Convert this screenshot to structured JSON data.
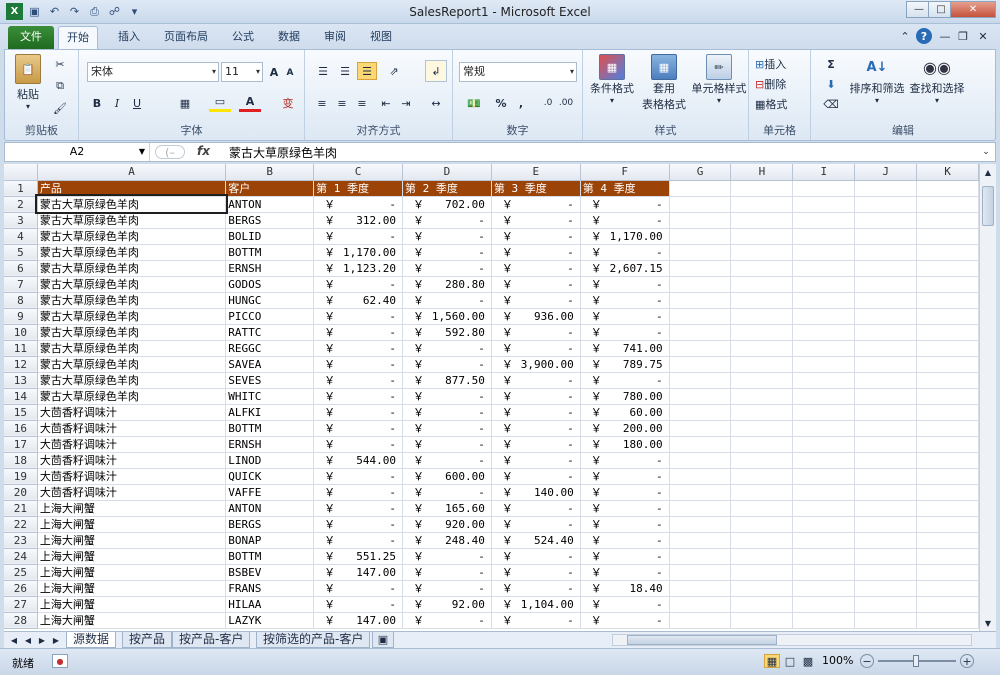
{
  "window": {
    "title": "SalesReport1 - Microsoft Excel"
  },
  "tabs": [
    {
      "label": "文件"
    },
    {
      "label": "开始"
    },
    {
      "label": "插入"
    },
    {
      "label": "页面布局"
    },
    {
      "label": "公式"
    },
    {
      "label": "数据"
    },
    {
      "label": "审阅"
    },
    {
      "label": "视图"
    }
  ],
  "ribbon": {
    "clipboard": {
      "label": "剪贴板",
      "paste": "粘贴"
    },
    "font": {
      "label": "字体",
      "name": "宋体",
      "size": "11",
      "bold": "B",
      "italic": "I",
      "underline": "U",
      "grow": "A",
      "shrink": "A",
      "fontcolor": "A",
      "phonetic": "变"
    },
    "alignment": {
      "label": "对齐方式"
    },
    "number": {
      "label": "数字",
      "format": "常规",
      "percent": "%",
      "comma": ","
    },
    "styles": {
      "label": "样式",
      "conditional": "条件格式",
      "table1": "套用",
      "table2": "表格格式",
      "cell": "单元格样式"
    },
    "cells": {
      "label": "单元格",
      "insert": "插入",
      "delete": "删除",
      "format": "格式"
    },
    "editing": {
      "label": "编辑",
      "sort": "排序和筛选",
      "find": "查找和选择"
    }
  },
  "formulabar": {
    "namebox": "A2",
    "fx": "fx",
    "content": "蒙古大草原绿色羊肉"
  },
  "columns": [
    "A",
    "B",
    "C",
    "D",
    "E",
    "F",
    "G",
    "H",
    "I",
    "J",
    "K"
  ],
  "header_row": [
    "产品",
    "客户",
    "第 1 季度",
    "第 2 季度",
    "第 3 季度",
    "第 4 季度"
  ],
  "rows": [
    {
      "n": "2",
      "p": "蒙古大草原绿色羊肉",
      "c": "ANTON",
      "q": [
        "-",
        "702.00",
        "-",
        "-"
      ]
    },
    {
      "n": "3",
      "p": "蒙古大草原绿色羊肉",
      "c": "BERGS",
      "q": [
        "312.00",
        "-",
        "-",
        "-"
      ]
    },
    {
      "n": "4",
      "p": "蒙古大草原绿色羊肉",
      "c": "BOLID",
      "q": [
        "-",
        "-",
        "-",
        "1,170.00"
      ]
    },
    {
      "n": "5",
      "p": "蒙古大草原绿色羊肉",
      "c": "BOTTM",
      "q": [
        "1,170.00",
        "-",
        "-",
        "-"
      ]
    },
    {
      "n": "6",
      "p": "蒙古大草原绿色羊肉",
      "c": "ERNSH",
      "q": [
        "1,123.20",
        "-",
        "-",
        "2,607.15"
      ]
    },
    {
      "n": "7",
      "p": "蒙古大草原绿色羊肉",
      "c": "GODOS",
      "q": [
        "-",
        "280.80",
        "-",
        "-"
      ]
    },
    {
      "n": "8",
      "p": "蒙古大草原绿色羊肉",
      "c": "HUNGC",
      "q": [
        "62.40",
        "-",
        "-",
        "-"
      ]
    },
    {
      "n": "9",
      "p": "蒙古大草原绿色羊肉",
      "c": "PICCO",
      "q": [
        "-",
        "1,560.00",
        "936.00",
        "-"
      ]
    },
    {
      "n": "10",
      "p": "蒙古大草原绿色羊肉",
      "c": "RATTC",
      "q": [
        "-",
        "592.80",
        "-",
        "-"
      ]
    },
    {
      "n": "11",
      "p": "蒙古大草原绿色羊肉",
      "c": "REGGC",
      "q": [
        "-",
        "-",
        "-",
        "741.00"
      ]
    },
    {
      "n": "12",
      "p": "蒙古大草原绿色羊肉",
      "c": "SAVEA",
      "q": [
        "-",
        "-",
        "3,900.00",
        "789.75"
      ]
    },
    {
      "n": "13",
      "p": "蒙古大草原绿色羊肉",
      "c": "SEVES",
      "q": [
        "-",
        "877.50",
        "-",
        "-"
      ]
    },
    {
      "n": "14",
      "p": "蒙古大草原绿色羊肉",
      "c": "WHITC",
      "q": [
        "-",
        "-",
        "-",
        "780.00"
      ]
    },
    {
      "n": "15",
      "p": "大茴香籽调味汁",
      "c": "ALFKI",
      "q": [
        "-",
        "-",
        "-",
        "60.00"
      ]
    },
    {
      "n": "16",
      "p": "大茴香籽调味汁",
      "c": "BOTTM",
      "q": [
        "-",
        "-",
        "-",
        "200.00"
      ]
    },
    {
      "n": "17",
      "p": "大茴香籽调味汁",
      "c": "ERNSH",
      "q": [
        "-",
        "-",
        "-",
        "180.00"
      ]
    },
    {
      "n": "18",
      "p": "大茴香籽调味汁",
      "c": "LINOD",
      "q": [
        "544.00",
        "-",
        "-",
        "-"
      ]
    },
    {
      "n": "19",
      "p": "大茴香籽调味汁",
      "c": "QUICK",
      "q": [
        "-",
        "600.00",
        "-",
        "-"
      ]
    },
    {
      "n": "20",
      "p": "大茴香籽调味汁",
      "c": "VAFFE",
      "q": [
        "-",
        "-",
        "140.00",
        "-"
      ]
    },
    {
      "n": "21",
      "p": "上海大闸蟹",
      "c": "ANTON",
      "q": [
        "-",
        "165.60",
        "-",
        "-"
      ]
    },
    {
      "n": "22",
      "p": "上海大闸蟹",
      "c": "BERGS",
      "q": [
        "-",
        "920.00",
        "-",
        "-"
      ]
    },
    {
      "n": "23",
      "p": "上海大闸蟹",
      "c": "BONAP",
      "q": [
        "-",
        "248.40",
        "524.40",
        "-"
      ]
    },
    {
      "n": "24",
      "p": "上海大闸蟹",
      "c": "BOTTM",
      "q": [
        "551.25",
        "-",
        "-",
        "-"
      ]
    },
    {
      "n": "25",
      "p": "上海大闸蟹",
      "c": "BSBEV",
      "q": [
        "147.00",
        "-",
        "-",
        "-"
      ]
    },
    {
      "n": "26",
      "p": "上海大闸蟹",
      "c": "FRANS",
      "q": [
        "-",
        "-",
        "-",
        "18.40"
      ]
    },
    {
      "n": "27",
      "p": "上海大闸蟹",
      "c": "HILAA",
      "q": [
        "-",
        "92.00",
        "1,104.00",
        "-"
      ]
    },
    {
      "n": "28",
      "p": "上海大闸蟹",
      "c": "LAZYK",
      "q": [
        "147.00",
        "-",
        "-",
        "-"
      ]
    }
  ],
  "currency_symbol": "￥",
  "sheets": [
    {
      "label": "源数据"
    },
    {
      "label": "按产品"
    },
    {
      "label": "按产品-客户"
    },
    {
      "label": "按筛选的产品-客户"
    }
  ],
  "status": {
    "ready": "就绪",
    "zoom": "100%"
  },
  "colors": {
    "header_fill": "#9c4407",
    "accent": "#2a6bb5"
  }
}
